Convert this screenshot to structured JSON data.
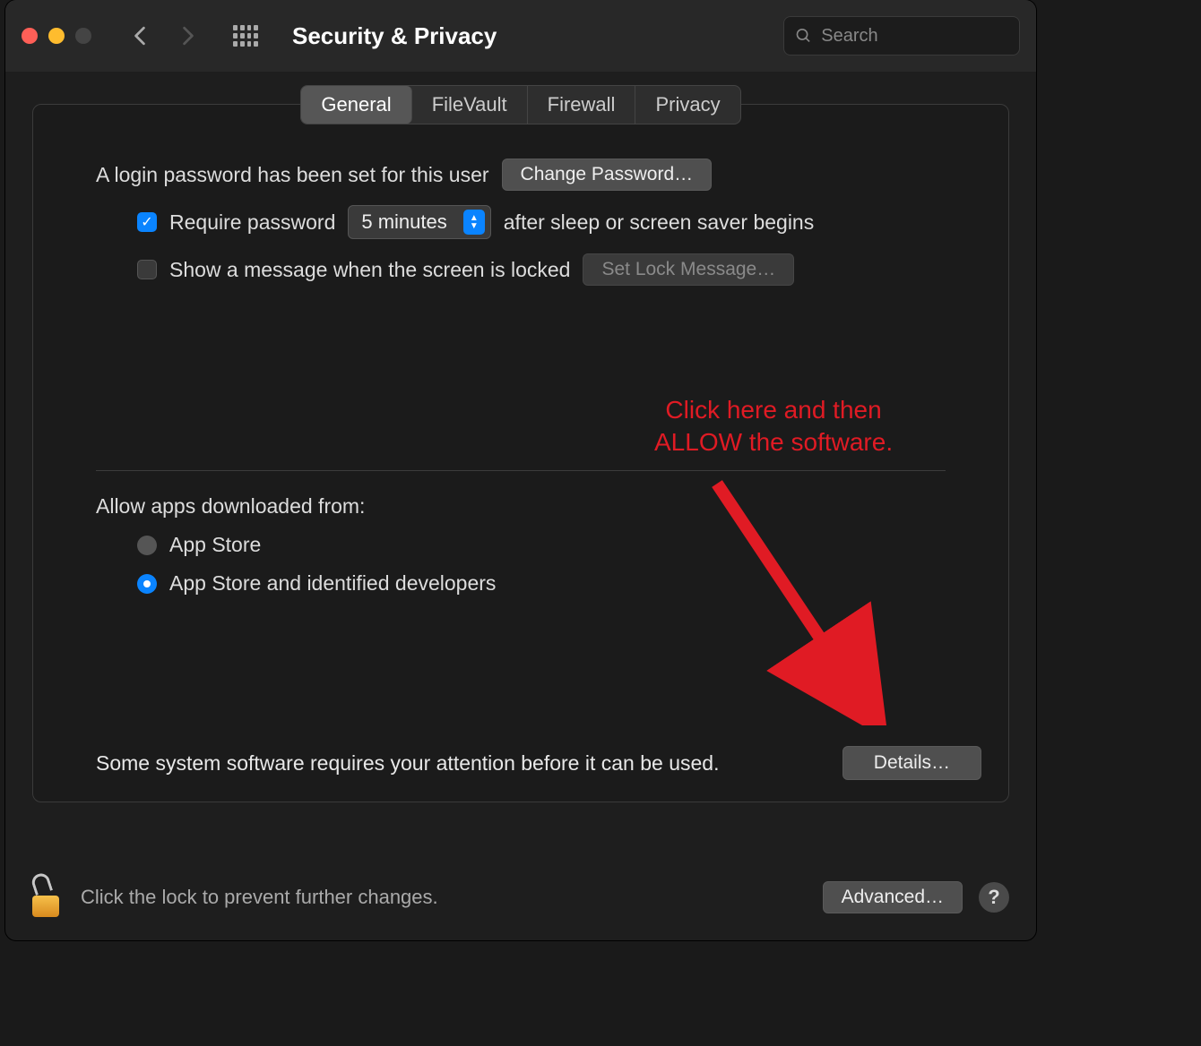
{
  "header": {
    "title": "Security & Privacy",
    "search_placeholder": "Search"
  },
  "tabs": {
    "general": "General",
    "filevault": "FileVault",
    "firewall": "Firewall",
    "privacy": "Privacy"
  },
  "general": {
    "login_pw_set": "A login password has been set for this user",
    "change_password_btn": "Change Password…",
    "require_password_pre": "Require password",
    "require_password_value": "5 minutes",
    "require_password_post": "after sleep or screen saver begins",
    "show_lock_message": "Show a message when the screen is locked",
    "set_lock_message_btn": "Set Lock Message…",
    "allow_apps_label": "Allow apps downloaded from:",
    "radio_appstore": "App Store",
    "radio_identified": "App Store and identified developers",
    "attention_text": "Some system software requires your attention before it can be used.",
    "details_btn": "Details…"
  },
  "footer": {
    "lock_text": "Click the lock to prevent further changes.",
    "advanced_btn": "Advanced…",
    "help": "?"
  },
  "annotation": {
    "line1": "Click here and then",
    "line2": "ALLOW the software."
  }
}
